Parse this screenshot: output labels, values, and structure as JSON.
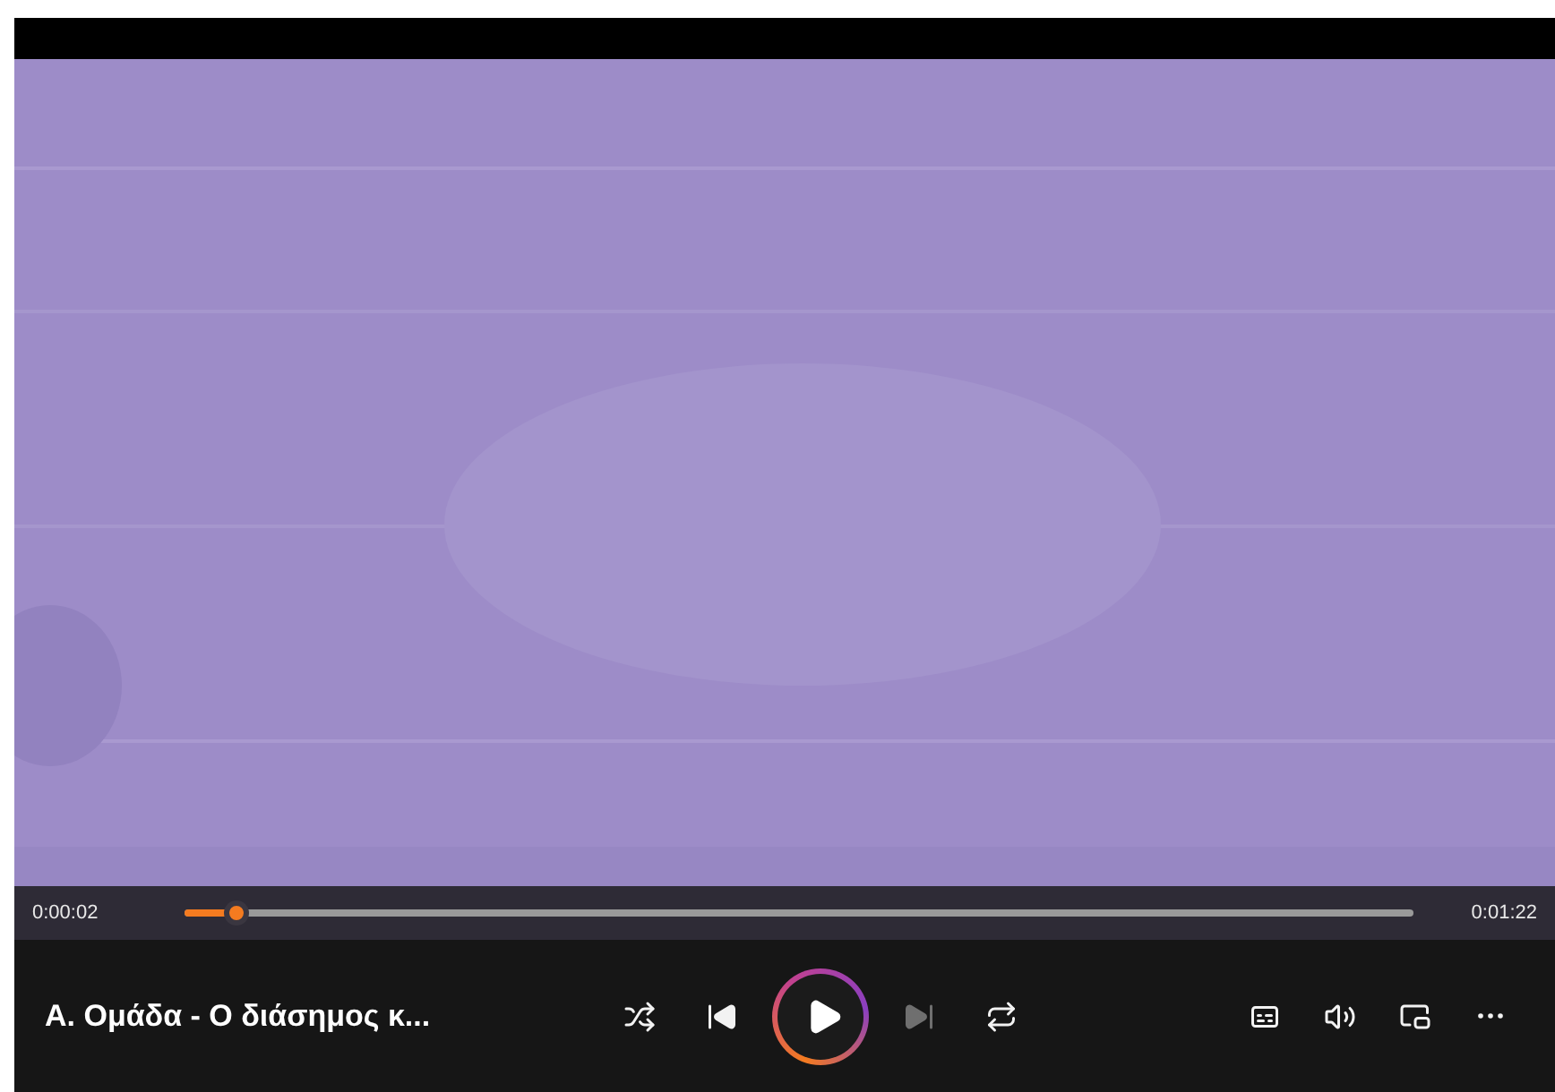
{
  "progress": {
    "elapsed": "0:00:02",
    "level": 0.043,
    "duration": "0:01:22"
  },
  "now_playing": {
    "title": "Α. Ομάδα - Ο διάσημος κ..."
  },
  "playback_controls": [
    {
      "kind": "shuffle",
      "disabled": false
    },
    {
      "kind": "previous",
      "disabled": false
    },
    {
      "kind": "play",
      "disabled": false
    },
    {
      "kind": "next",
      "disabled": true
    },
    {
      "kind": "repeat",
      "disabled": false
    }
  ],
  "tools": [
    {
      "kind": "captions"
    },
    {
      "kind": "volume"
    },
    {
      "kind": "mini"
    },
    {
      "kind": "more"
    }
  ]
}
